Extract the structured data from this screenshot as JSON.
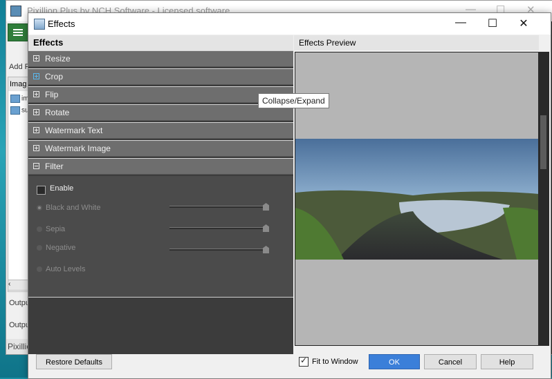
{
  "background_window": {
    "title": "Pixillion Plus by NCH Software - Licensed software",
    "add_label": "Add F",
    "images_header": "Imag",
    "images": [
      "im",
      "su"
    ],
    "output_rows": [
      "Outpu",
      "Outpu"
    ],
    "status": "Pixillio"
  },
  "dialog": {
    "title": "Effects",
    "left_header": "Effects",
    "right_header": "Effects Preview",
    "sections": [
      {
        "label": "Resize",
        "expanded": false
      },
      {
        "label": "Crop",
        "expanded": false
      },
      {
        "label": "Flip",
        "expanded": false
      },
      {
        "label": "Rotate",
        "expanded": false
      },
      {
        "label": "Watermark Text",
        "expanded": false
      },
      {
        "label": "Watermark Image",
        "expanded": false
      },
      {
        "label": "Filter",
        "expanded": true
      }
    ],
    "filter": {
      "enable_label": "Enable",
      "enabled": false,
      "options": [
        {
          "label": "Black and White",
          "selected": true,
          "slider_value": 1.0
        },
        {
          "label": "Sepia",
          "selected": false,
          "slider_value": 1.0
        },
        {
          "label": "Negative",
          "selected": false,
          "slider_value": 1.0
        },
        {
          "label": "Auto Levels",
          "selected": false
        }
      ]
    },
    "tooltip": "Collapse/Expand",
    "buttons": {
      "restore": "Restore Defaults",
      "fit_to_window": "Fit to Window",
      "fit_checked": true,
      "ok": "OK",
      "cancel": "Cancel",
      "help": "Help"
    }
  },
  "colors": {
    "accent": "#3b7fd9",
    "section_bg": "#6e6e6e",
    "panel_bg": "#3c3c3c",
    "hover_icon": "#59b8ee"
  },
  "icons": [
    "hamburger-icon",
    "plus-square-icon",
    "minus-square-icon",
    "close-icon",
    "maximize-icon",
    "minimize-icon"
  ]
}
